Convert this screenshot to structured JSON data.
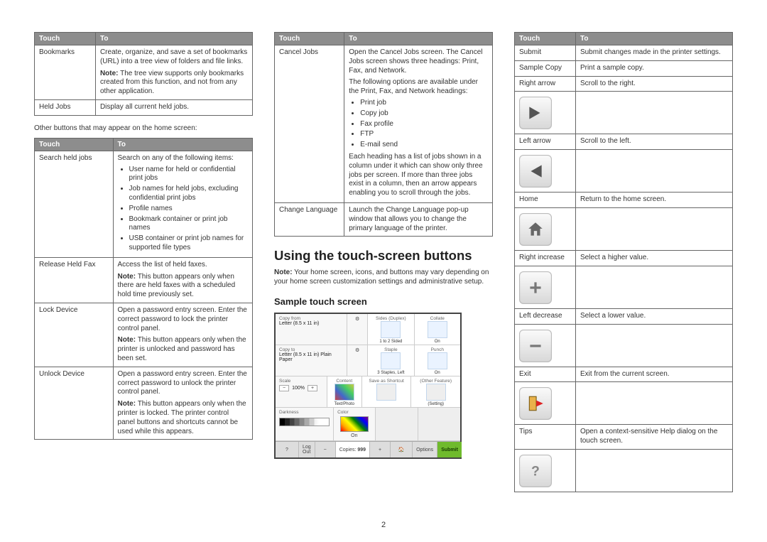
{
  "headers": {
    "touch": "Touch",
    "to": "To"
  },
  "col1": {
    "table1": [
      {
        "touch": "Bookmarks",
        "to": "Create, organize, and save a set of bookmarks (URL) into a tree view of folders and file links.",
        "note": "The tree view supports only bookmarks created from this function, and not from any other application."
      },
      {
        "touch": "Held Jobs",
        "to": "Display all current held jobs."
      }
    ],
    "between": "Other buttons that may appear on the home screen:",
    "table2": [
      {
        "touch": "Search held jobs",
        "to": "Search on any of the following items:",
        "bullets": [
          "User name for held or confidential print jobs",
          "Job names for held jobs, excluding confidential print jobs",
          "Profile names",
          "Bookmark container or print job names",
          "USB container or print job names for supported file types"
        ]
      },
      {
        "touch": "Release Held Fax",
        "to": "Access the list of held faxes.",
        "note": "This button appears only when there are held faxes with a scheduled hold time previously set."
      },
      {
        "touch": "Lock Device",
        "to": "Open a password entry screen. Enter the correct password to lock the printer control panel.",
        "note": "This button appears only when the printer is unlocked and password has been set."
      },
      {
        "touch": "Unlock Device",
        "to": "Open a password entry screen. Enter the correct password to unlock the printer control panel.",
        "note": "This button appears only when the printer is locked. The printer control panel buttons and shortcuts cannot be used while this appears."
      }
    ]
  },
  "col2": {
    "table1": [
      {
        "touch": "Cancel Jobs",
        "to": "Open the Cancel Jobs screen. The Cancel Jobs screen shows three headings: Print, Fax, and Network.",
        "extra": "The following options are available under the Print, Fax, and Network headings:",
        "bullets": [
          "Print job",
          "Copy job",
          "Fax profile",
          "FTP",
          "E-mail send"
        ],
        "tail": "Each heading has a list of jobs shown in a column under it which can show only three jobs per screen. If more than three jobs exist in a column, then an arrow appears enabling you to scroll through the jobs."
      },
      {
        "touch": "Change Language",
        "to": "Launch the Change Language pop-up window that allows you to change the primary language of the printer."
      }
    ],
    "h2": "Using the touch-screen buttons",
    "noteline": "Your home screen, icons, and buttons may vary depending on your home screen customization settings and administrative setup.",
    "h3": "Sample touch screen",
    "sample": {
      "copy_from_label": "Copy from",
      "copy_from_val": "Letter (8.5 x 11 in)",
      "copy_to_label": "Copy to",
      "copy_to_val": "Letter (8.5 x 11 in) Plain Paper",
      "sides": "Sides (Duplex)",
      "sides_val": "1 to 2 Sided",
      "collate": "Collate",
      "collate_val": "On",
      "scale": "Scale",
      "scale_val": "100%",
      "content": "Content",
      "content_val": "Text/Photo",
      "staple": "Staple",
      "staple_val": "3 Staples, Left",
      "punch": "Punch",
      "punch_val": "On",
      "darkness": "Darkness",
      "color": "Color",
      "color_val": "On",
      "save_as": "Save as Shortcut",
      "other": "(Other Feature)",
      "setting": "(Setting)",
      "logout": "Log Out",
      "copies": "Copies:",
      "copies_val": "999",
      "options": "Options",
      "submit": "Submit"
    }
  },
  "col3": {
    "table": [
      {
        "touch": "Submit",
        "to": "Submit changes made in the printer settings."
      },
      {
        "touch": "Sample Copy",
        "to": "Print a sample copy."
      },
      {
        "touch": "Right arrow",
        "to": "Scroll to the right.",
        "icon": "right"
      },
      {
        "touch": "Left arrow",
        "to": "Scroll to the left.",
        "icon": "left"
      },
      {
        "touch": "Home",
        "to": "Return to the home screen.",
        "icon": "home"
      },
      {
        "touch": "Right increase",
        "to": "Select a higher value.",
        "icon": "plus"
      },
      {
        "touch": "Left decrease",
        "to": "Select a lower value.",
        "icon": "minus"
      },
      {
        "touch": "Exit",
        "to": "Exit from the current screen.",
        "icon": "exit"
      },
      {
        "touch": "Tips",
        "to": "Open a context-sensitive Help dialog on the touch screen.",
        "icon": "question"
      }
    ]
  },
  "page_number": "2",
  "note_label": "Note:"
}
